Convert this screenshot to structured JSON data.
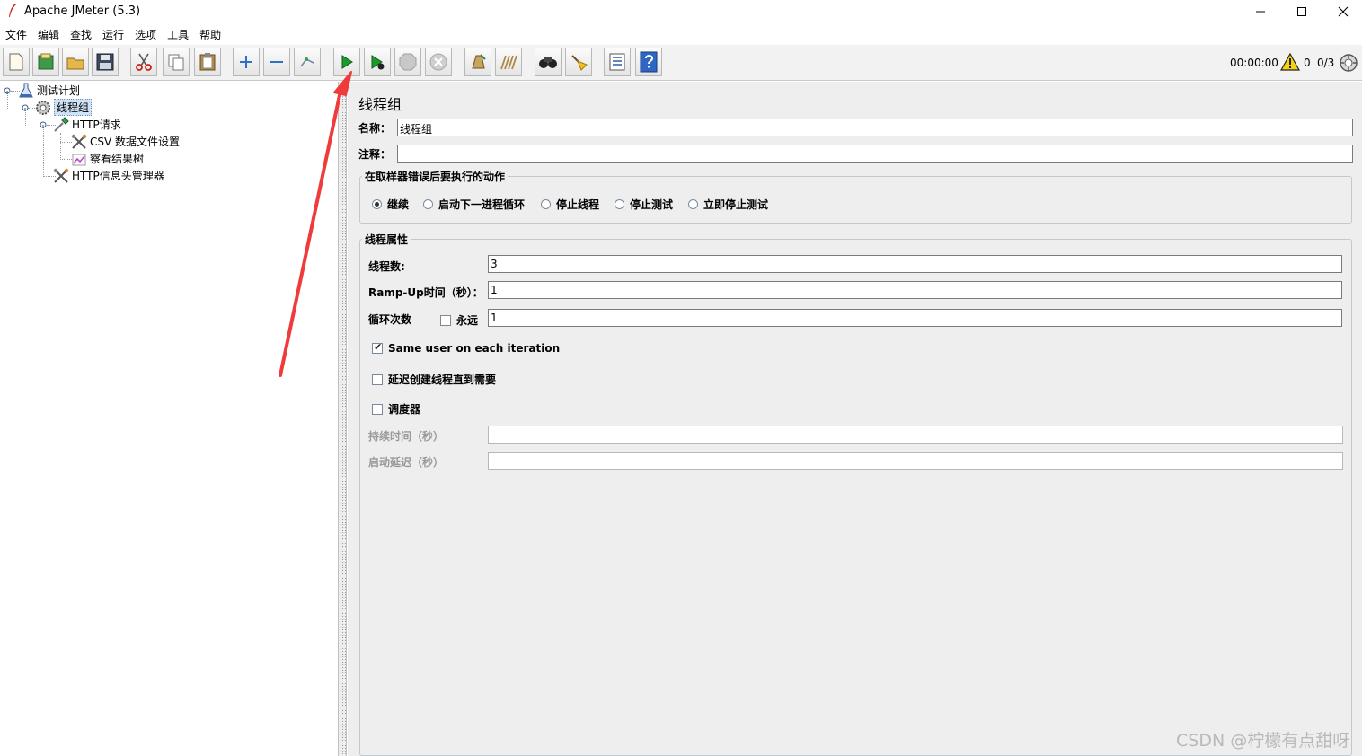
{
  "window": {
    "title": "Apache JMeter (5.3)"
  },
  "menu": [
    "文件",
    "编辑",
    "查找",
    "运行",
    "选项",
    "工具",
    "帮助"
  ],
  "toolbar": {
    "timer": "00:00:00",
    "warning_count": "0",
    "threads": "0/3",
    "buttons": [
      "new-icon",
      "templates-icon",
      "open-icon",
      "save-icon",
      "cut-icon",
      "copy-icon",
      "paste-icon",
      "expand-icon",
      "collapse-icon",
      "toggle-icon",
      "start-icon",
      "start-no-pause-icon",
      "stop-icon",
      "shutdown-icon",
      "clear-icon",
      "clear-all-icon",
      "search-icon",
      "reset-search-icon",
      "function-helper-icon",
      "help-icon"
    ]
  },
  "tree": {
    "test_plan": "测试计划",
    "thread_group": "线程组",
    "http_request": "HTTP请求",
    "csv_config": "CSV 数据文件设置",
    "result_tree": "察看结果树",
    "header_manager": "HTTP信息头管理器"
  },
  "panel": {
    "title": "线程组",
    "name_label": "名称：",
    "name_value": "线程组",
    "comment_label": "注释：",
    "comment_value": "",
    "error_group_title": "在取样器错误后要执行的动作",
    "error_actions": [
      "继续",
      "启动下一进程循环",
      "停止线程",
      "停止测试",
      "立即停止测试"
    ],
    "selected_action": "继续",
    "thread_props_title": "线程属性",
    "num_threads_label": "线程数:",
    "num_threads_value": "3",
    "rampup_label": "Ramp-Up时间（秒）：",
    "rampup_value": "1",
    "loop_label": "循环次数",
    "forever_label": "永远",
    "forever_checked": false,
    "loop_value": "1",
    "same_user_label": "Same user on each iteration",
    "same_user_checked": true,
    "delay_create_label": "延迟创建线程直到需要",
    "delay_create_checked": false,
    "scheduler_label": "调度器",
    "scheduler_checked": false,
    "duration_label": "持续时间（秒）",
    "duration_value": "",
    "startup_delay_label": "启动延迟（秒）",
    "startup_delay_value": ""
  },
  "watermark": "CSDN @柠檬有点甜呀",
  "colors": {
    "annotation_arrow": "#ef3b3b",
    "selection": "#cfe3f5",
    "start_button": "#1c9a2c"
  }
}
